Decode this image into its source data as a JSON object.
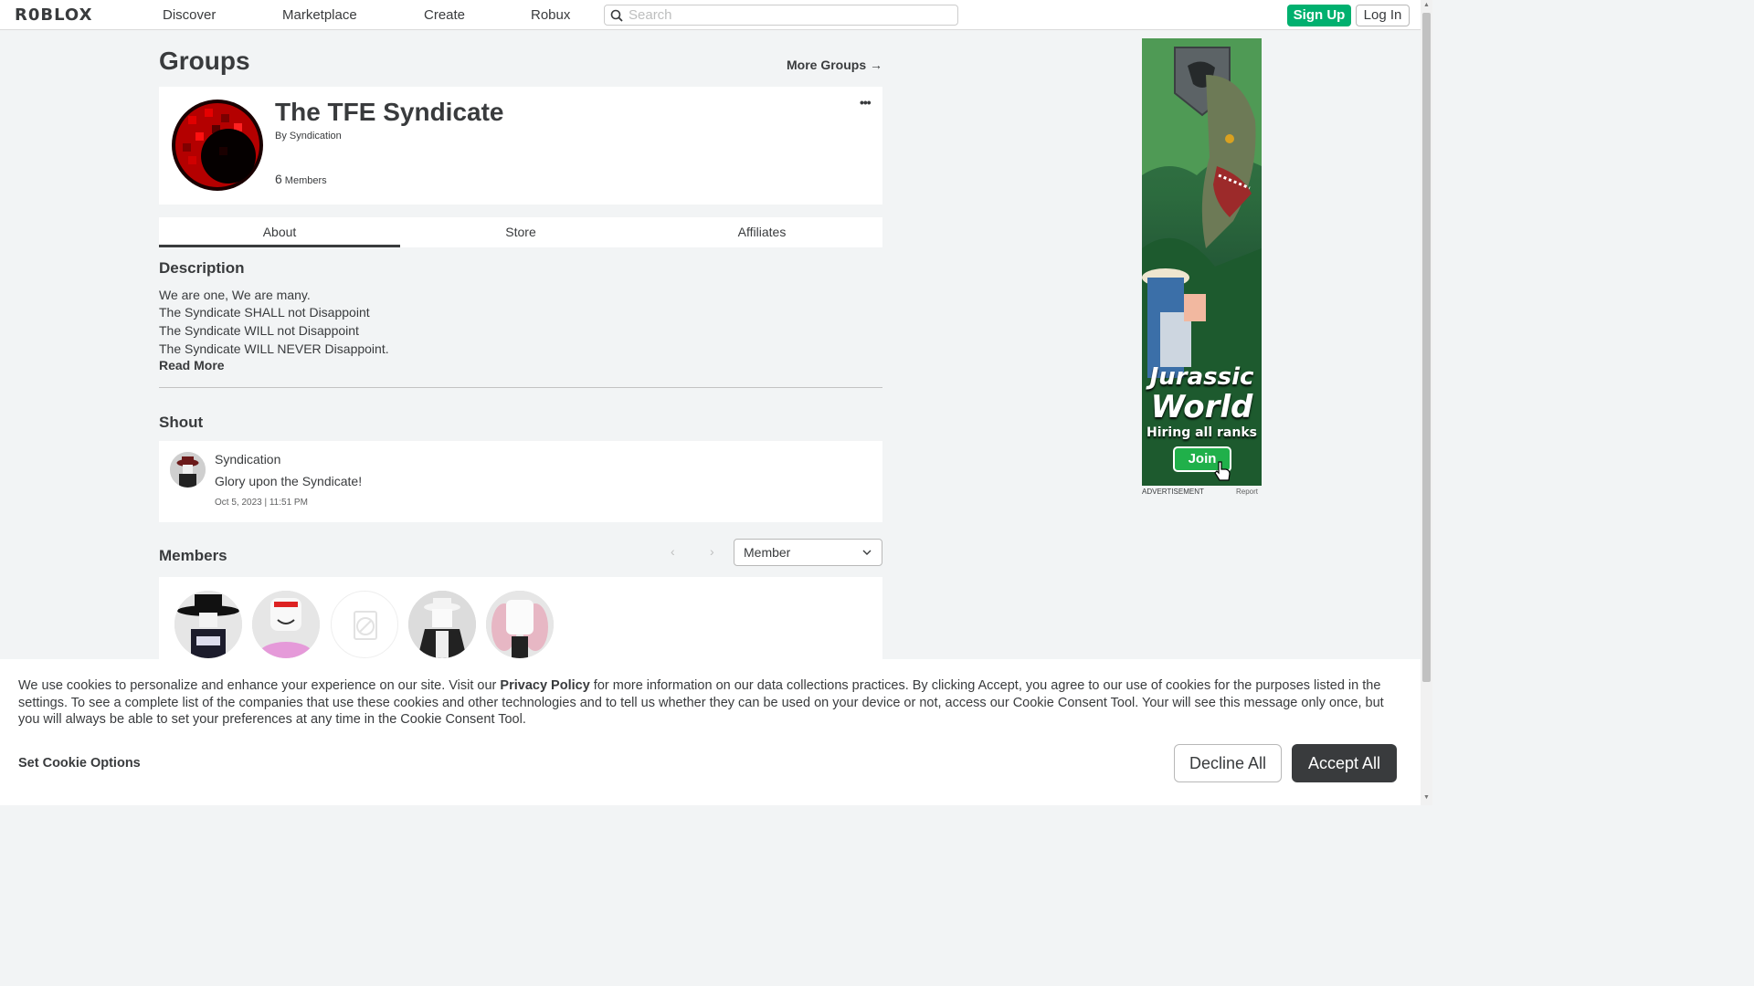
{
  "nav": {
    "logo": "R0BLOX",
    "links": [
      "Discover",
      "Marketplace",
      "Create",
      "Robux"
    ],
    "search_placeholder": "Search",
    "signup": "Sign Up",
    "login": "Log In"
  },
  "page": {
    "title": "Groups",
    "more_groups": "More Groups →"
  },
  "group": {
    "name": "The TFE Syndicate",
    "by_prefix": "By",
    "owner": "Syndication",
    "member_count": "6",
    "member_label": "Members",
    "more_icon": "•••"
  },
  "tabs": [
    "About",
    "Store",
    "Affiliates"
  ],
  "description": {
    "heading": "Description",
    "lines": [
      "We are one, We are many.",
      "The Syndicate SHALL not Disappoint",
      "The Syndicate WILL not Disappoint",
      "The Syndicate WILL NEVER Disappoint."
    ],
    "read_more": "Read More"
  },
  "shout": {
    "heading": "Shout",
    "author": "Syndication",
    "text": "Glory upon the Syndicate!",
    "date": "Oct 5, 2023 | 11:51 PM"
  },
  "members": {
    "heading": "Members",
    "prev": "‹",
    "next": "›",
    "rank_selected": "Member"
  },
  "ad": {
    "title_1": "Jurassic",
    "title_2": "World",
    "subtitle": "Hiring all ranks",
    "join": "Join",
    "label": "ADVERTISEMENT",
    "report": "Report"
  },
  "cookie": {
    "text_before": "We use cookies to personalize and enhance your experience on our site. Visit our ",
    "link": "Privacy Policy",
    "text_after": " for more information on our data collections practices. By clicking Accept, you agree to our use of cookies for the purposes listed in the settings. To see a complete list of the companies that use these cookies and other technologies and to tell us whether they can be used on your device or not, access our Cookie Consent Tool. Your will see this message only once, but you will always be able to set your preferences at any time in the Cookie Consent Tool.",
    "set_options": "Set Cookie Options",
    "decline": "Decline All",
    "accept": "Accept All"
  }
}
